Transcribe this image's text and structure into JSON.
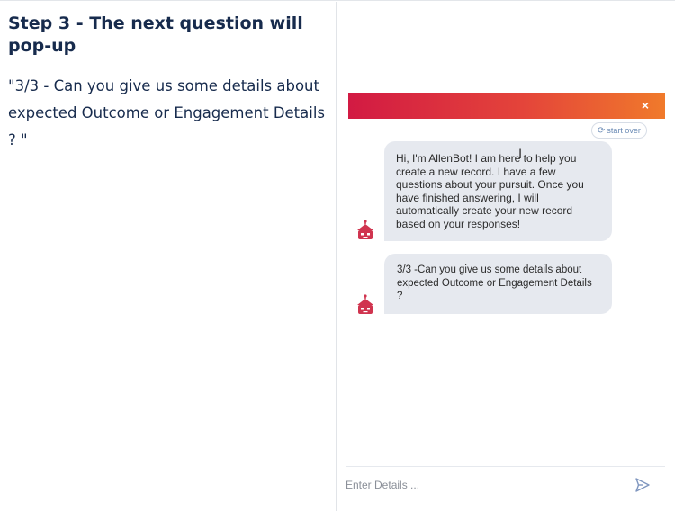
{
  "instructions": {
    "step_title": "Step 3 - The next question will pop-up",
    "step_description": "\"3/3 - Can you give us some details about expected Outcome or Engagement Details ? \""
  },
  "chatbot": {
    "close_label": "×",
    "start_over_label": "start over",
    "messages": [
      {
        "sender": "bot",
        "text": "Hi, I'm AllenBot! I am here to help you create a new record. I have a few questions about your pursuit. Once you have finished answering, I will automatically create your new record based on your responses!"
      },
      {
        "sender": "bot",
        "text": "3/3 -Can you give us some details about expected Outcome or  Engagement Details ?"
      }
    ],
    "input_placeholder": "Enter Details ...",
    "input_value": "",
    "colors": {
      "header_gradient_start": "#d21a43",
      "header_gradient_end": "#f07a2b",
      "bubble_background": "#e6e9ef",
      "avatar_color": "#d0344f"
    },
    "icons": {
      "close": "close-icon",
      "start_over": "refresh-icon",
      "avatar": "robot-avatar-icon",
      "send": "send-icon"
    }
  }
}
